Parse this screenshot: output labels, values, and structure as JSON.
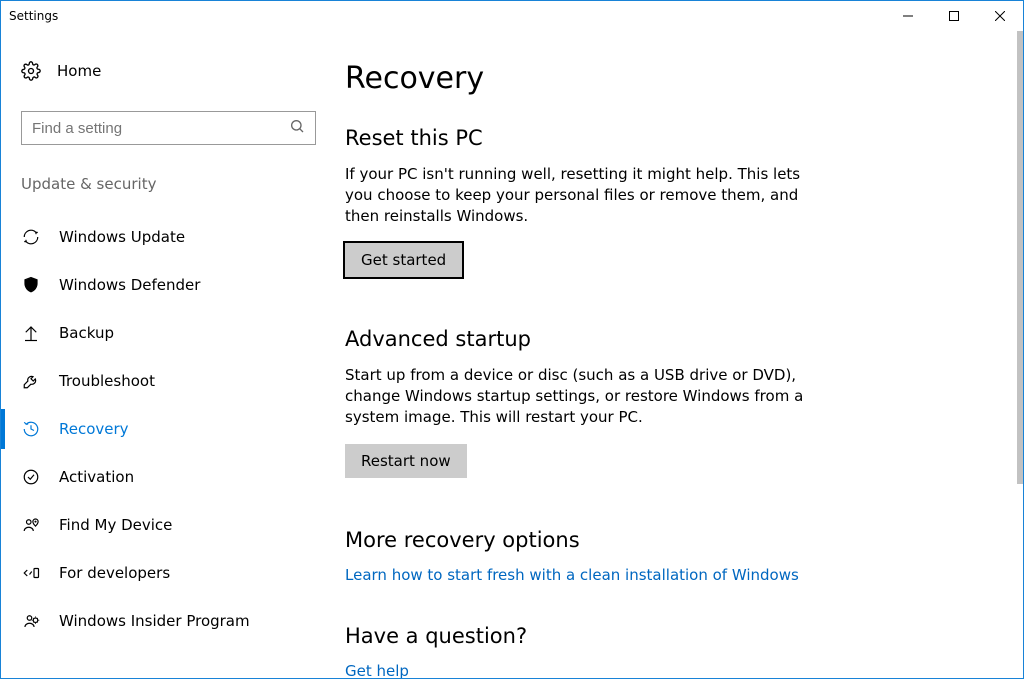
{
  "window": {
    "title": "Settings"
  },
  "sidebar": {
    "home_label": "Home",
    "search_placeholder": "Find a setting",
    "category_label": "Update & security",
    "items": [
      {
        "label": "Windows Update",
        "icon": "sync-icon",
        "selected": false
      },
      {
        "label": "Windows Defender",
        "icon": "shield-icon",
        "selected": false
      },
      {
        "label": "Backup",
        "icon": "backup-arrow-icon",
        "selected": false
      },
      {
        "label": "Troubleshoot",
        "icon": "wrench-icon",
        "selected": false
      },
      {
        "label": "Recovery",
        "icon": "history-icon",
        "selected": true
      },
      {
        "label": "Activation",
        "icon": "check-circle-icon",
        "selected": false
      },
      {
        "label": "Find My Device",
        "icon": "location-person-icon",
        "selected": false
      },
      {
        "label": "For developers",
        "icon": "developer-icon",
        "selected": false
      },
      {
        "label": "Windows Insider Program",
        "icon": "insider-icon",
        "selected": false
      }
    ]
  },
  "content": {
    "page_title": "Recovery",
    "reset": {
      "heading": "Reset this PC",
      "body": "If your PC isn't running well, resetting it might help. This lets you choose to keep your personal files or remove them, and then reinstalls Windows.",
      "button": "Get started"
    },
    "advanced": {
      "heading": "Advanced startup",
      "body": "Start up from a device or disc (such as a USB drive or DVD), change Windows startup settings, or restore Windows from a system image. This will restart your PC.",
      "button": "Restart now"
    },
    "more": {
      "heading": "More recovery options",
      "link": "Learn how to start fresh with a clean installation of Windows"
    },
    "question": {
      "heading": "Have a question?",
      "link": "Get help"
    }
  }
}
